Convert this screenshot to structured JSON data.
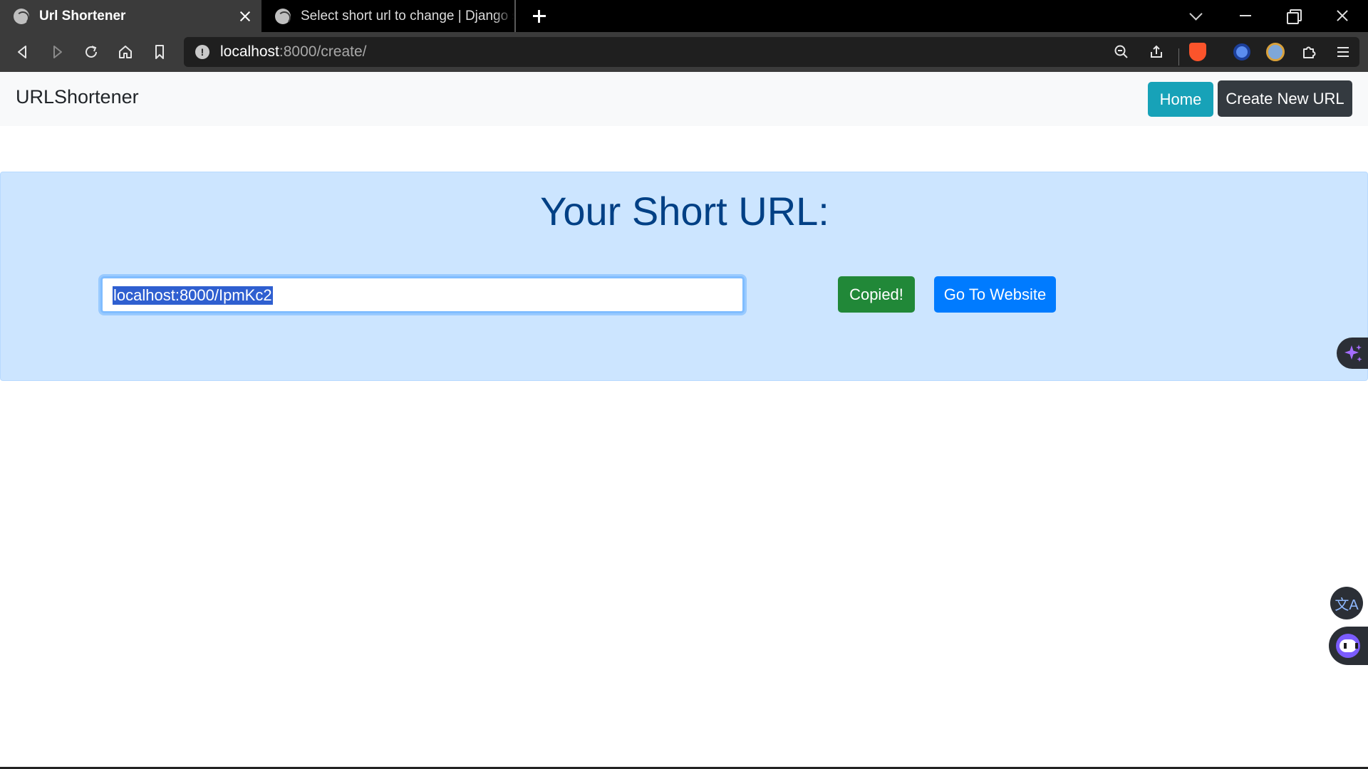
{
  "browser": {
    "tabs": [
      {
        "title": "Url Shortener",
        "active": true
      },
      {
        "title": "Select short url to change | Django site admin",
        "active": false
      }
    ],
    "address": {
      "host": "localhost",
      "path": ":8000/create/"
    }
  },
  "navbar": {
    "brand": "URLShortener",
    "home_label": "Home",
    "create_label": "Create New URL"
  },
  "result": {
    "heading": "Your Short URL:",
    "short_url": "localhost:8000/IpmKc2",
    "copied_label": "Copied!",
    "go_label": "Go To Website"
  },
  "floating": {
    "translate_glyph": "文A"
  },
  "colors": {
    "jumbotron_bg": "#cce5ff",
    "heading": "#004085",
    "home_button": "#17a2b8",
    "create_button": "#343a40",
    "copied_button": "#218838",
    "go_button": "#007bff"
  }
}
